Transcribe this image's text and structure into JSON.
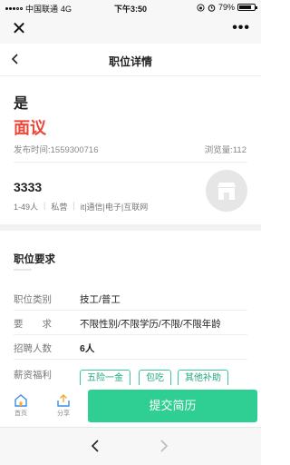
{
  "status_bar": {
    "carrier": "中国联通",
    "network": "4G",
    "time": "下午3:50",
    "battery": "79%",
    "battery_level": 0.79
  },
  "nav": {
    "title": "职位详情"
  },
  "job": {
    "title": "是",
    "salary": "面议",
    "publish_time": "发布时间:1559300716",
    "views": "浏览量:112"
  },
  "company": {
    "name": "3333",
    "size": "1-49人",
    "type": "私营",
    "industry": "it|通信|电子|互联网"
  },
  "requirements": {
    "section_title": "职位要求",
    "rows": [
      {
        "label": "职位类别",
        "value": "技工/普工"
      },
      {
        "label": "要　　求",
        "value": "不限性别/不限学历/不限/不限年龄"
      },
      {
        "label": "招聘人数",
        "value": "6人"
      },
      {
        "label": "薪资福利",
        "value": ""
      }
    ],
    "benefits": [
      "五险一金",
      "包吃",
      "其他补助"
    ]
  },
  "bottom_bar": {
    "home_label": "首页",
    "share_label": "分享",
    "submit_label": "提交简历",
    "accent_color": "#2fce93"
  }
}
